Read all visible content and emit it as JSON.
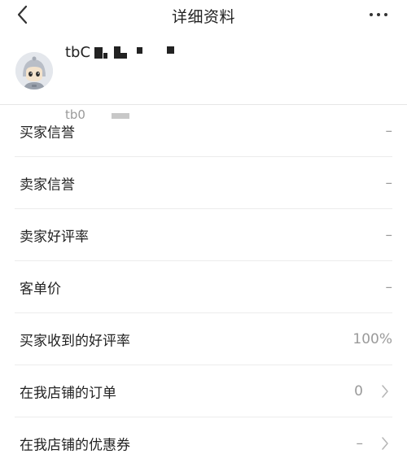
{
  "header": {
    "title": "详细资料",
    "back_icon": "chevron-left-icon",
    "more_icon": "more-horizontal-icon"
  },
  "profile": {
    "username_prefix": "tbC",
    "sub_id_prefix": "tb0",
    "avatar_icon": "robot-avatar"
  },
  "rows": [
    {
      "label": "买家信誉",
      "value": "–",
      "chevron": false
    },
    {
      "label": "卖家信誉",
      "value": "–",
      "chevron": false
    },
    {
      "label": "卖家好评率",
      "value": "–",
      "chevron": false
    },
    {
      "label": "客单价",
      "value": "–",
      "chevron": false
    },
    {
      "label": "买家收到的好评率",
      "value": "100%",
      "chevron": false
    },
    {
      "label": "在我店铺的订单",
      "value": "0",
      "chevron": true
    },
    {
      "label": "在我店铺的优惠券",
      "value": "–",
      "chevron": true
    }
  ]
}
